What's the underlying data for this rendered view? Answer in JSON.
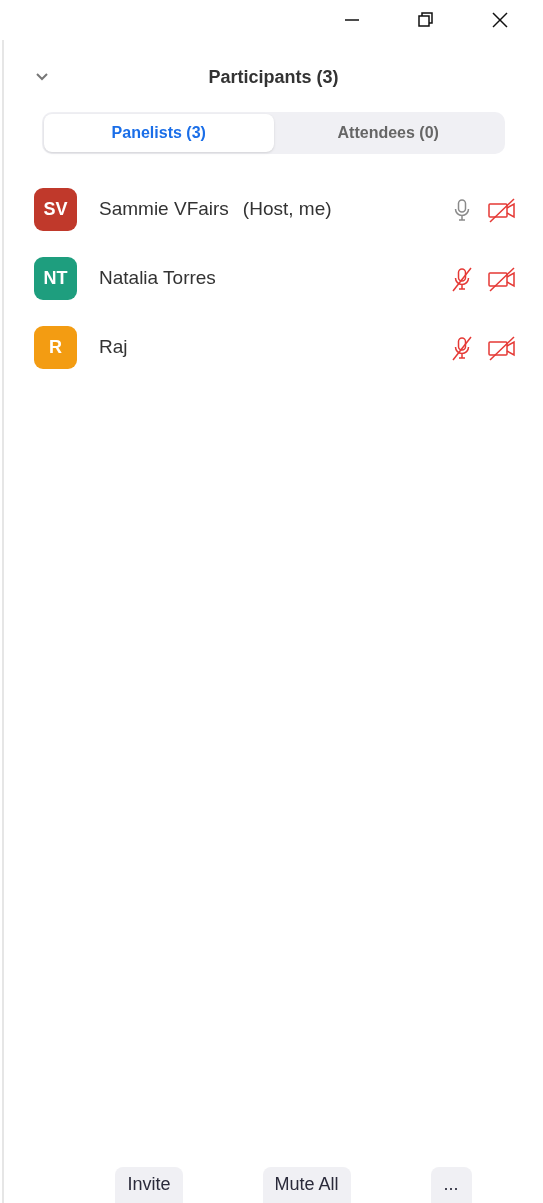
{
  "header": {
    "title": "Participants (3)"
  },
  "tabs": [
    {
      "label": "Panelists (3)",
      "selected": true
    },
    {
      "label": "Attendees (0)",
      "selected": false
    }
  ],
  "participants": [
    {
      "initials": "SV",
      "name": "Sammie VFairs",
      "role": "(Host, me)",
      "color": "#c0392b",
      "mic_muted": false,
      "video_off": true
    },
    {
      "initials": "NT",
      "name": "Natalia Torres",
      "color": "#1e9e7e",
      "mic_muted": true,
      "video_off": true
    },
    {
      "initials": "R",
      "name": "Raj",
      "color": "#f39c12",
      "mic_muted": true,
      "video_off": true
    }
  ],
  "footer_buttons": [
    "Invite",
    "Mute All",
    "..."
  ]
}
